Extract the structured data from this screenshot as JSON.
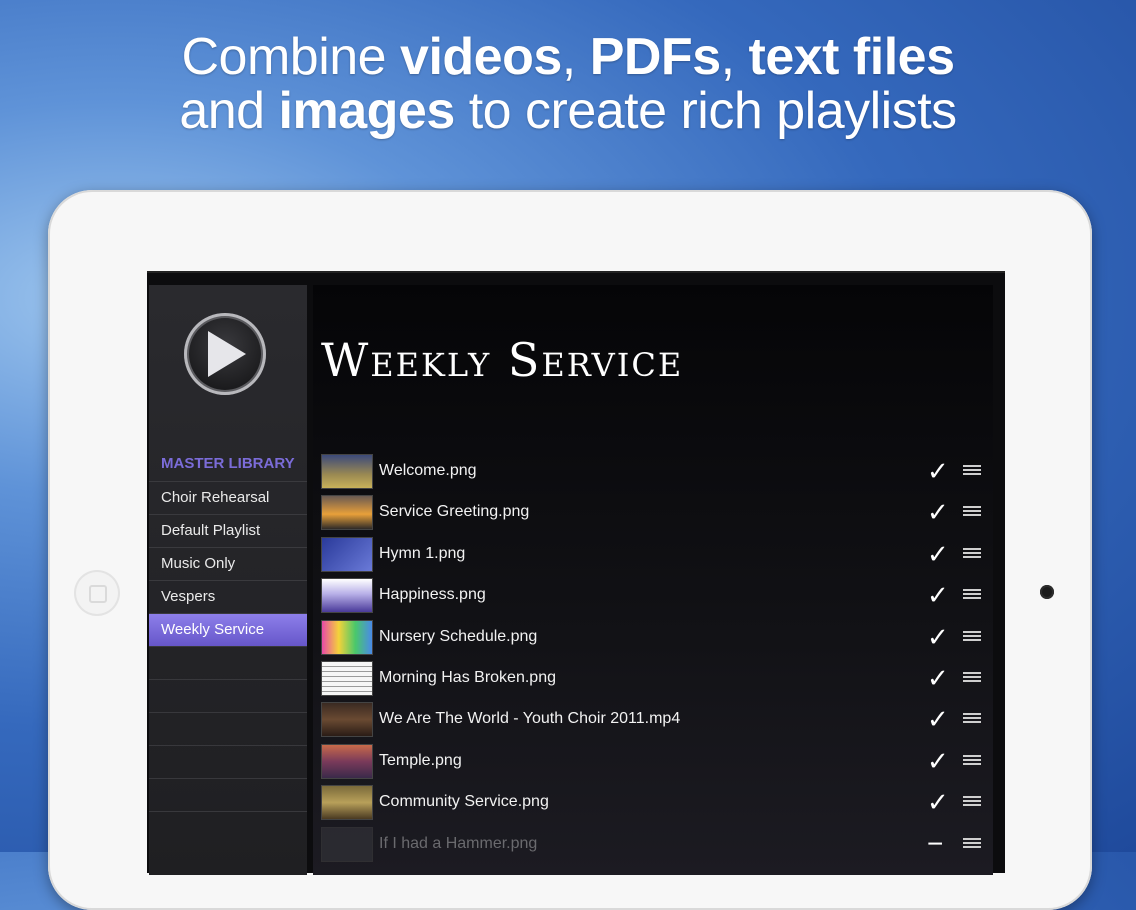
{
  "headline": {
    "line1_a": "Combine ",
    "line1_b": "videos",
    "line1_c": ", ",
    "line1_d": "PDFs",
    "line1_e": ", ",
    "line1_f": "text files",
    "line2_a": "and ",
    "line2_b": "images",
    "line2_c": " to create rich playlists"
  },
  "sidebar": {
    "header": "MASTER LIBRARY",
    "items": [
      {
        "label": "Choir Rehearsal"
      },
      {
        "label": "Default Playlist"
      },
      {
        "label": "Music Only"
      },
      {
        "label": "Vespers"
      },
      {
        "label": "Weekly Service",
        "active": true
      }
    ]
  },
  "main": {
    "title": "Weekly Service",
    "rows": [
      {
        "label": "Welcome.png",
        "check": "✓"
      },
      {
        "label": "Service Greeting.png",
        "check": "✓"
      },
      {
        "label": "Hymn 1.png",
        "check": "✓"
      },
      {
        "label": "Happiness.png",
        "check": "✓"
      },
      {
        "label": "Nursery Schedule.png",
        "check": "✓"
      },
      {
        "label": "Morning Has Broken.png",
        "check": "✓"
      },
      {
        "label": "We Are The World - Youth Choir 2011.mp4",
        "check": "✓"
      },
      {
        "label": "Temple.png",
        "check": "✓"
      },
      {
        "label": "Community Service.png",
        "check": "✓"
      },
      {
        "label": "If I had a Hammer.png",
        "check": "−"
      }
    ]
  },
  "colors": {
    "accent": "#7b6cd8",
    "active_item": "#7a6bde",
    "background": "#3569bd"
  },
  "icons": {
    "logo": "play-circle-icon",
    "row_status": "checkmark-icon",
    "row_reorder": "drag-handle-icon"
  }
}
